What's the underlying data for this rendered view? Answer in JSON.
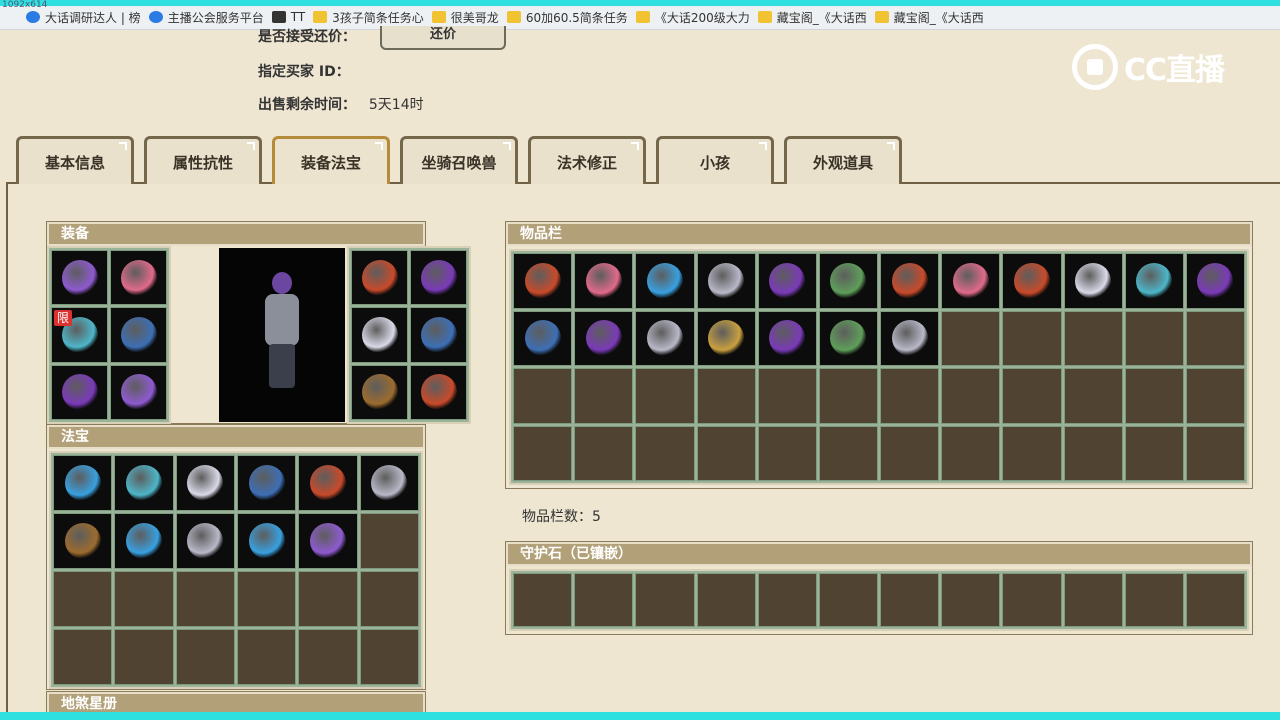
{
  "browser": {
    "resolution_text": "1092x614",
    "bookmarks": [
      {
        "label": "大话调研达人 | 榜",
        "icon": "blue"
      },
      {
        "label": "主播公会服务平台",
        "icon": "blue"
      },
      {
        "label": "TT",
        "icon": "dark"
      },
      {
        "label": "3孩子简条任务心",
        "icon": "folder"
      },
      {
        "label": "很美哥龙",
        "icon": "folder"
      },
      {
        "label": "60加60.5简条任务",
        "icon": "folder"
      },
      {
        "label": "《大话200级大力",
        "icon": "folder"
      },
      {
        "label": "藏宝阁_《大话西",
        "icon": "folder"
      },
      {
        "label": "藏宝阁_《大话西",
        "icon": "folder"
      }
    ]
  },
  "header": {
    "accept_counter_label": "是否接受还价：",
    "counter_button": "还价",
    "buyer_id_label": "指定买家 ID：",
    "buyer_id_value": "",
    "time_left_label": "出售剩余时间：",
    "time_left_value": "5天14时"
  },
  "logo": {
    "text": "CC直播"
  },
  "tabs": [
    "基本信息",
    "属性抗性",
    "装备法宝",
    "坐骑召唤兽",
    "法术修正",
    "小孩",
    "外观道具"
  ],
  "active_tab": "装备法宝",
  "panels": {
    "equipment": {
      "title": "装备",
      "limit_tag": "限"
    },
    "treasure": {
      "title": "法宝"
    },
    "bottom_cut": {
      "title": "地煞星册"
    },
    "inventory": {
      "title": "物品栏"
    },
    "inventory_count_label": "物品栏数：",
    "inventory_count_value": "5",
    "guard_stone": {
      "title": "守护石（已镶嵌）"
    }
  },
  "colors": {
    "accent_cyan": "#2fe0e0",
    "panel_head": "#b2a079",
    "slot_empty": "#504331",
    "page_bg": "#efe6d2"
  },
  "items": {
    "equipment_left": [
      "helmet-icon",
      "staff-icon",
      "limited-spear-icon",
      "robe-icon",
      "flail-icon",
      "boots-icon"
    ],
    "equipment_right": [
      "mask-icon",
      "necklace-icon",
      "ring-icon",
      "ring-icon",
      "belt-icon",
      "orb-icon"
    ],
    "treasure": [
      "bag-icon",
      "shield-icon",
      "lute-icon",
      "hook-icon",
      "gauntlet-icon",
      "talisman-icon",
      "scroll-icon",
      "wand-icon",
      "flame-icon",
      "mirror-icon",
      "mace-icon"
    ],
    "inventory": [
      "whip-icon",
      "skirt-icon",
      "dress-icon",
      "needle-icon",
      "shoes-icon",
      "pipe-icon",
      "blue-swirl-icon",
      "silver-ring-icon",
      "purple-swirl-icon",
      "flail-icon",
      "white-orb-icon",
      "helmet-icon",
      "pendant-icon",
      "necklace-icon",
      "green-sword-icon",
      "boots-icon",
      "cloak-icon",
      "ring-icon",
      "axe-icon"
    ]
  }
}
